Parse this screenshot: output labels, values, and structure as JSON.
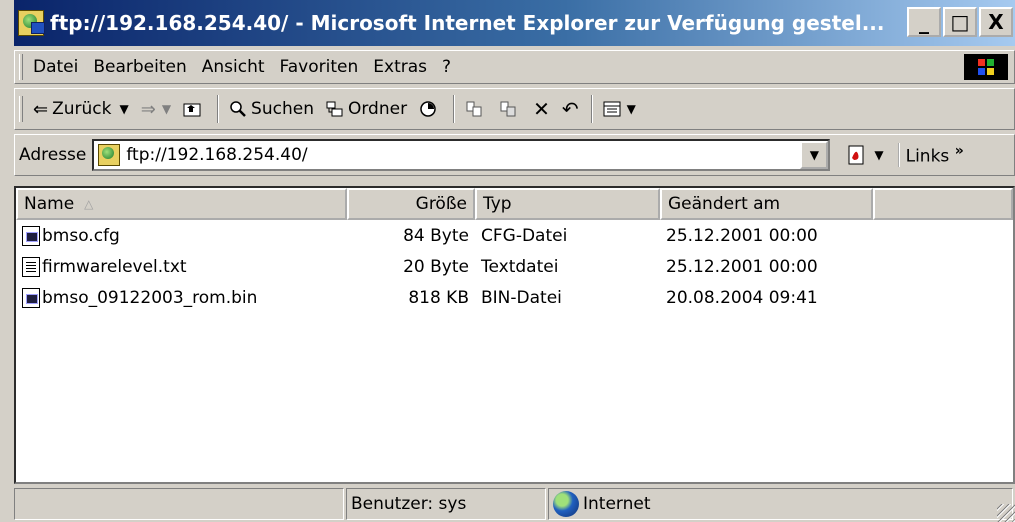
{
  "window": {
    "title": "ftp://192.168.254.40/ - Microsoft Internet Explorer  zur Verfügung gestel...",
    "minimize": "_",
    "maximize": "□",
    "close": "X"
  },
  "menu": {
    "items": [
      {
        "label": "Datei"
      },
      {
        "label": "Bearbeiten"
      },
      {
        "label": "Ansicht"
      },
      {
        "label": "Favoriten"
      },
      {
        "label": "Extras"
      },
      {
        "label": "?"
      }
    ]
  },
  "toolbar": {
    "back_label": "Zurück",
    "search_label": "Suchen",
    "folders_label": "Ordner"
  },
  "address": {
    "label": "Adresse",
    "value": "ftp://192.168.254.40/",
    "links_label": "Links",
    "more": "»"
  },
  "list": {
    "columns": [
      {
        "label": "Name"
      },
      {
        "label": "Größe"
      },
      {
        "label": "Typ"
      },
      {
        "label": "Geändert am"
      }
    ],
    "rows": [
      {
        "name": "bmso.cfg",
        "size": "84 Byte",
        "type": "CFG-Datei",
        "modified": "25.12.2001 00:00",
        "icon": "bin-file-icon"
      },
      {
        "name": "firmwarelevel.txt",
        "size": "20 Byte",
        "type": "Textdatei",
        "modified": "25.12.2001 00:00",
        "icon": "text-file-icon"
      },
      {
        "name": "bmso_09122003_rom.bin",
        "size": "818 KB",
        "type": "BIN-Datei",
        "modified": "20.08.2004 09:41",
        "icon": "bin-file-icon"
      }
    ]
  },
  "status": {
    "user": "Benutzer: sys",
    "zone": "Internet"
  },
  "colors": {
    "title_start": "#0a246a",
    "title_end": "#a6caf0",
    "chrome": "#d4d0c8"
  }
}
